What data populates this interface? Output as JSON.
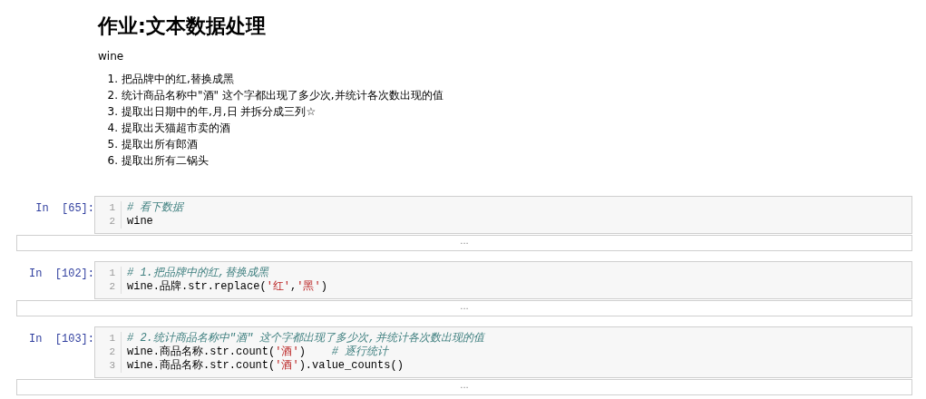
{
  "title": "作业:文本数据处理",
  "subtitle": "wine",
  "tasks": [
    {
      "marker": "1.",
      "text": "把品牌中的红,替换成黑"
    },
    {
      "marker": "2.",
      "text": "统计商品名称中\"酒\" 这个字都出现了多少次,并统计各次数出现的值"
    },
    {
      "marker": "3.",
      "text": "提取出日期中的年,月,日 并拆分成三列☆"
    },
    {
      "marker": "4.",
      "text": "提取出天猫超市卖的酒"
    },
    {
      "marker": "5.",
      "text": "提取出所有郎酒"
    },
    {
      "marker": "6.",
      "text": "提取出所有二锅头"
    }
  ],
  "cells": [
    {
      "prompt": "In  [65]:",
      "lines": [
        {
          "number": "1",
          "tokens": [
            {
              "kind": "comment",
              "text": "# 看下数据"
            }
          ]
        },
        {
          "number": "2",
          "tokens": [
            {
              "kind": "plain",
              "text": "wine"
            }
          ]
        }
      ],
      "output": "..."
    },
    {
      "prompt": "In  [102]:",
      "lines": [
        {
          "number": "1",
          "tokens": [
            {
              "kind": "comment",
              "text": "# 1.把品牌中的红,替换成黑"
            }
          ]
        },
        {
          "number": "2",
          "tokens": [
            {
              "kind": "plain",
              "text": "wine.品牌.str.replace("
            },
            {
              "kind": "string",
              "text": "'红'"
            },
            {
              "kind": "plain",
              "text": ","
            },
            {
              "kind": "string",
              "text": "'黑'"
            },
            {
              "kind": "plain",
              "text": ")"
            }
          ]
        }
      ],
      "output": "..."
    },
    {
      "prompt": "In  [103]:",
      "lines": [
        {
          "number": "1",
          "tokens": [
            {
              "kind": "comment",
              "text": "# 2.统计商品名称中\"酒\" 这个字都出现了多少次,并统计各次数出现的值"
            }
          ]
        },
        {
          "number": "2",
          "tokens": [
            {
              "kind": "plain",
              "text": "wine.商品名称.str.count("
            },
            {
              "kind": "string",
              "text": "'酒'"
            },
            {
              "kind": "plain",
              "text": ")    "
            },
            {
              "kind": "comment",
              "text": "# 逐行统计"
            }
          ]
        },
        {
          "number": "3",
          "tokens": [
            {
              "kind": "plain",
              "text": "wine.商品名称.str.count("
            },
            {
              "kind": "string",
              "text": "'酒'"
            },
            {
              "kind": "plain",
              "text": ").value_counts()"
            }
          ]
        }
      ],
      "output": "..."
    }
  ]
}
